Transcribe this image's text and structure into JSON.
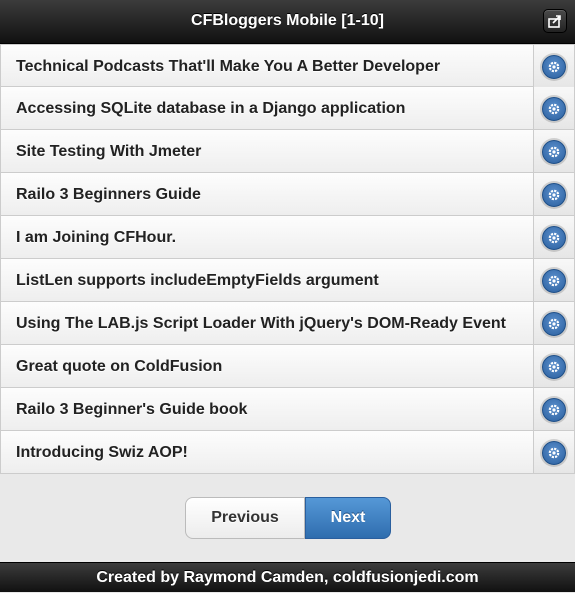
{
  "header": {
    "title": "CFBloggers Mobile [1-10]",
    "action_icon": "share-icon"
  },
  "items": [
    {
      "label": "Technical Podcasts That'll Make You A Better Developer",
      "icon": "gear-icon"
    },
    {
      "label": "Accessing SQLite database in a Django application",
      "icon": "gear-icon"
    },
    {
      "label": "Site Testing With Jmeter",
      "icon": "gear-icon"
    },
    {
      "label": "Railo 3 Beginners Guide",
      "icon": "gear-icon"
    },
    {
      "label": "I am Joining CFHour.",
      "icon": "gear-icon"
    },
    {
      "label": "ListLen supports includeEmptyFields argument",
      "icon": "gear-icon"
    },
    {
      "label": "Using The LAB.js Script Loader With jQuery's DOM-Ready Event",
      "icon": "gear-icon"
    },
    {
      "label": "Great quote on ColdFusion",
      "icon": "gear-icon"
    },
    {
      "label": "Railo 3 Beginner's Guide book",
      "icon": "gear-icon"
    },
    {
      "label": "Introducing Swiz AOP!",
      "icon": "gear-icon"
    }
  ],
  "pager": {
    "previous_label": "Previous",
    "next_label": "Next"
  },
  "footer": {
    "text": "Created by Raymond Camden, coldfusionjedi.com"
  },
  "colors": {
    "bar_dark": "#111111",
    "accent_blue": "#2f6dae",
    "list_bg": "#f4f4f4"
  }
}
